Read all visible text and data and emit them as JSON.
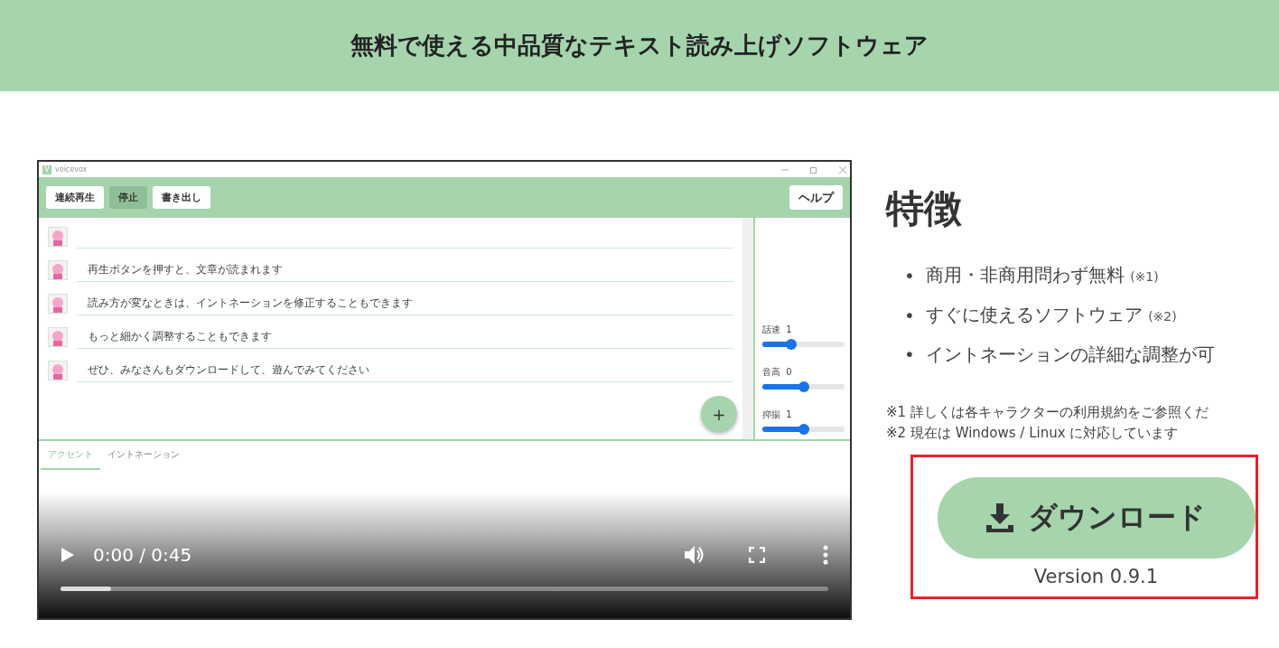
{
  "header": {
    "title": "無料で使える中品質なテキスト読み上げソフトウェア"
  },
  "video": {
    "app": {
      "logo_letter": "V",
      "title": "voicevox",
      "toolbar": [
        {
          "label": "連続再生",
          "selected": false
        },
        {
          "label": "停止",
          "selected": true
        },
        {
          "label": "書き出し",
          "selected": false
        }
      ],
      "help_button": "ヘルプ",
      "rows": [
        {
          "kind": "blank"
        },
        {
          "kind": "text",
          "text": "再生ボタンを押すと、文章が読まれます"
        },
        {
          "kind": "text",
          "text": "読み方が変なときは、イントネーションを修正することもできます"
        },
        {
          "kind": "text",
          "text": "もっと細かく調整することもできます"
        },
        {
          "kind": "text",
          "text": "ぜひ、みなさんもダウンロードして、遊んでみてください"
        }
      ],
      "add_button": "+",
      "sliders": [
        {
          "label": "話速",
          "value": "1",
          "level": 0.35
        },
        {
          "label": "音高",
          "value": "0",
          "level": 0.5
        },
        {
          "label": "抑揚",
          "value": "1",
          "level": 0.5
        }
      ],
      "tabs": [
        {
          "label": "アクセント",
          "selected": true
        },
        {
          "label": "イントネーション",
          "selected": false
        }
      ]
    },
    "time": "0:00 / 0:45",
    "progress": {
      "level": 0.066
    }
  },
  "features": {
    "heading": "特徴",
    "items": [
      {
        "marker": "•",
        "text": "商用・非商用問わず無料",
        "note": "(※1)"
      },
      {
        "marker": "•",
        "text": "すぐに使えるソフトウェア",
        "note": "(※2)"
      },
      {
        "marker": "•",
        "text": "イントネーションの詳細な調整が可"
      }
    ],
    "notes": [
      "※1 詳しくは各キャラクターの利用規約をご参照くだ",
      "※2 現在は Windows / Linux に対応しています"
    ]
  },
  "download": {
    "label": "ダウンロード",
    "version": "Version 0.9.1"
  }
}
